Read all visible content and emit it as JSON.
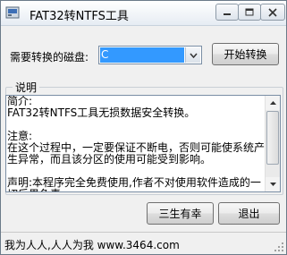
{
  "window": {
    "title": "FAT32转NTFS工具"
  },
  "drive": {
    "label": "需要转换的磁盘:",
    "selected": "C"
  },
  "buttons": {
    "start": "开始转换",
    "sanshen": "三生有幸",
    "exit": "退出"
  },
  "description": {
    "group_title": "说明",
    "text": "简介:\nFAT32转NTFS工具无损数据安全转换。\n\n注意:\n在这个过程中，一定要保证不断电，否则可能使系统产生异常，而且该分区的使用可能受到影响。\n\n声明:本程序完全免费使用,作者不对使用软件造成的一切后果负责。"
  },
  "statusbar": {
    "text": "我为人人,人人为我 www.3464.com"
  },
  "icons": {
    "app": "app-icon",
    "minimize": "minimize-icon",
    "maximize": "maximize-icon",
    "close": "close-icon",
    "dropdown": "chevron-down-icon"
  }
}
